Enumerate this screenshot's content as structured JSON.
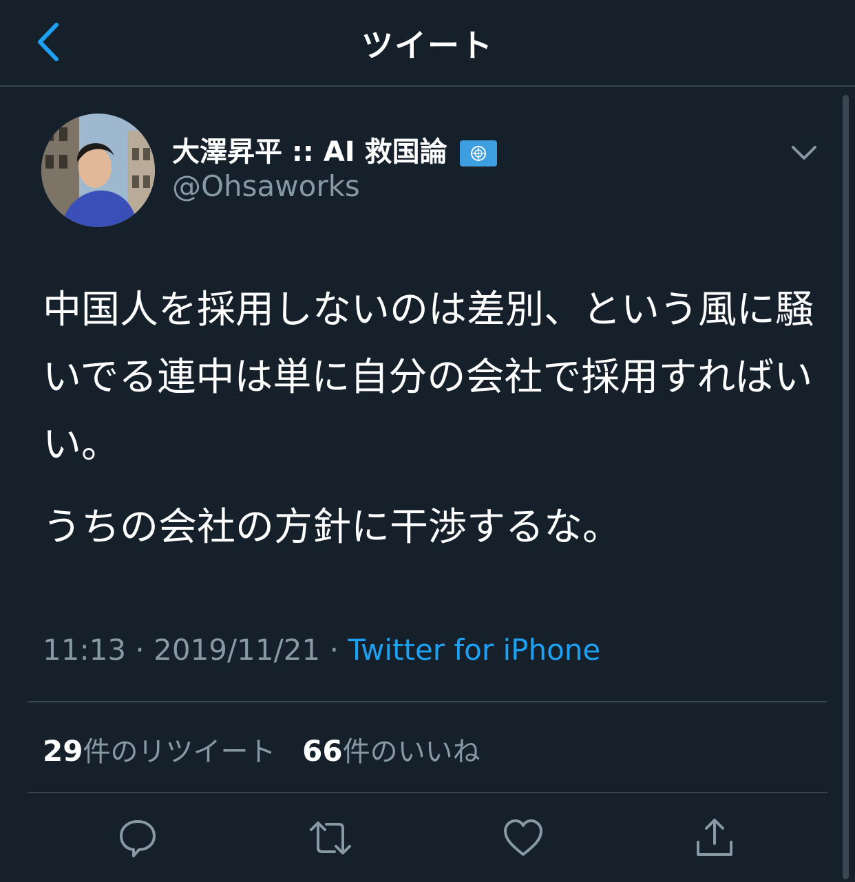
{
  "header": {
    "title": "ツイート",
    "back_icon": "chevron-left-icon"
  },
  "colors": {
    "background": "#15202b",
    "accent": "#1da1f2",
    "muted": "#8899a6",
    "divider": "#38444d"
  },
  "tweet": {
    "display_name": "大澤昇平 :: AI 救国論",
    "name_emoji": "un-flag-icon",
    "handle": "@Ohsaworks",
    "body": [
      "中国人を採用しないのは差別、という風に騒いでる連中は単に自分の会社で採用すればいい。",
      "うちの会社の方針に干渉するな。"
    ],
    "time": "11:13",
    "date": "2019/11/21",
    "separator": "·",
    "source": "Twitter for iPhone"
  },
  "stats": {
    "retweets_count": "29",
    "retweets_label": "件のリツイート",
    "likes_count": "66",
    "likes_label": "件のいいね"
  },
  "actions": [
    "reply-icon",
    "retweet-icon",
    "like-icon",
    "share-icon"
  ]
}
